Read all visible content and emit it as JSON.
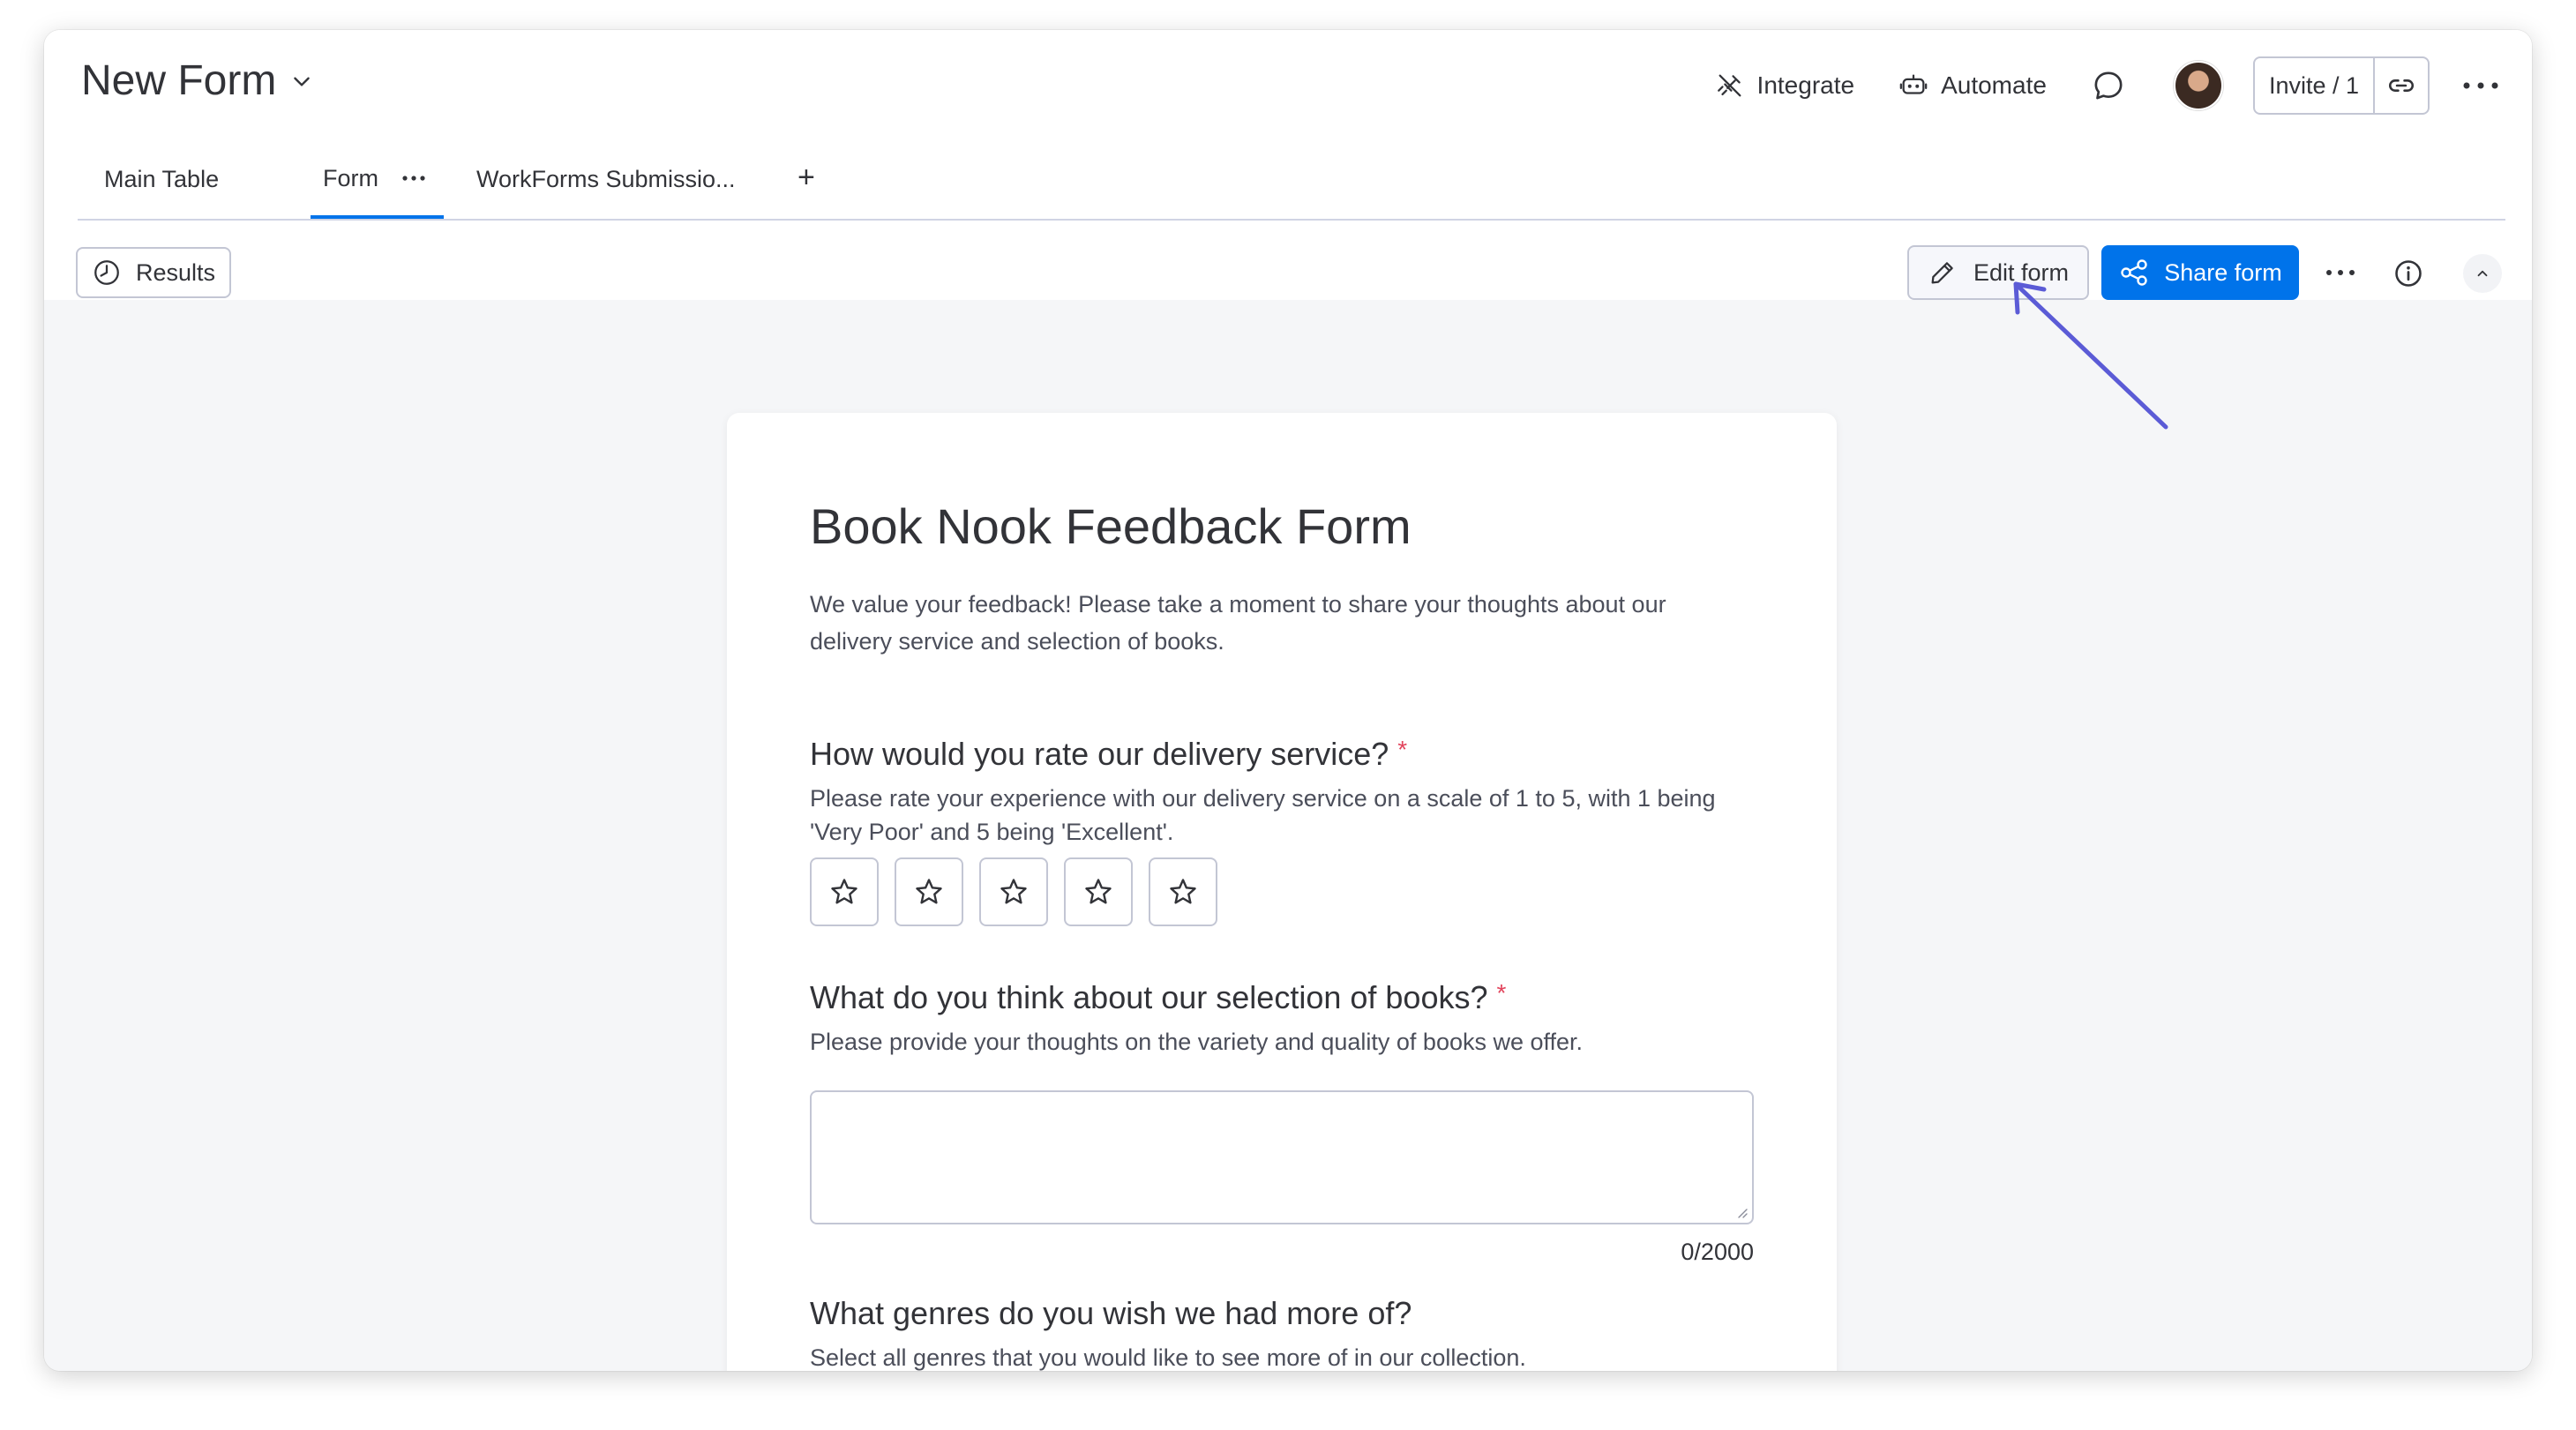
{
  "header": {
    "board_title": "New Form",
    "actions": {
      "integrate": "Integrate",
      "automate": "Automate"
    },
    "invite_label": "Invite / 1"
  },
  "tabs": [
    {
      "label": "Main Table"
    },
    {
      "label": "Form",
      "active": true
    },
    {
      "label": "WorkForms Submissio..."
    }
  ],
  "tab_add": "+",
  "toolbar": {
    "results_label": "Results",
    "edit_label": "Edit form",
    "share_label": "Share form"
  },
  "colors": {
    "accent": "#0073ea",
    "annotation_arrow": "#5b5bd6",
    "required": "#e2445c"
  },
  "form": {
    "title": "Book Nook Feedback Form",
    "description": "We value your feedback! Please take a moment to share your thoughts about our delivery service and selection of books.",
    "questions": [
      {
        "title": "How would you rate our delivery service?",
        "required_mark": "*",
        "description": "Please rate your experience with our delivery service on a scale of 1 to 5, with 1 being 'Very Poor' and 5 being 'Excellent'.",
        "type": "rating",
        "stars": 5
      },
      {
        "title": "What do you think about our selection of books?",
        "required_mark": "*",
        "description": "Please provide your thoughts on the variety and quality of books we offer.",
        "type": "long_text",
        "value": "",
        "counter": "0/2000"
      },
      {
        "title": "What genres do you wish we had more of?",
        "description": "Select all genres that you would like to see more of in our collection.",
        "type": "multi_select"
      }
    ]
  },
  "icons": {
    "title_dropdown": "chevron-down-icon",
    "integrate": "integrate-icon",
    "automate": "robot-icon",
    "chat": "chat-bubble-icon",
    "link": "link-icon",
    "more": "more-horizontal-icon",
    "results": "clock-icon",
    "edit": "pencil-icon",
    "share": "share-nodes-icon",
    "info": "info-icon",
    "collapse": "chevron-up-icon",
    "star": "star-outline-icon"
  }
}
